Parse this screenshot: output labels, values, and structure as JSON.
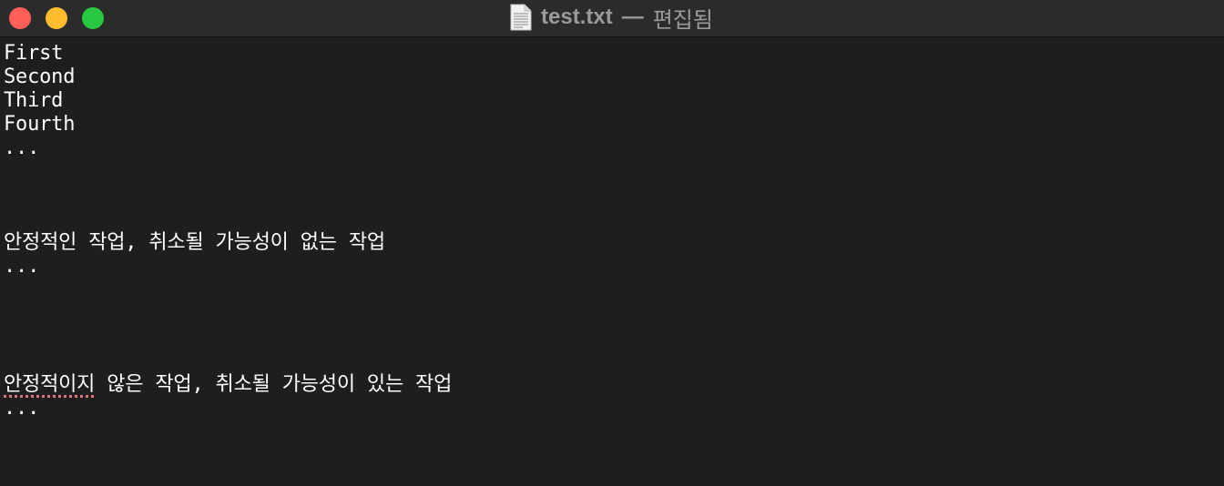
{
  "window": {
    "title": "test.txt",
    "title_separator": "—",
    "title_status": "편집됨",
    "document_icon": "text-document-icon",
    "buttons": {
      "close_color": "#ff5f57",
      "minimize_color": "#febc2e",
      "zoom_color": "#28c840"
    }
  },
  "colors": {
    "titlebar_bg": "#2b2b2b",
    "editor_bg": "#1e1e1e",
    "text": "#ffffff",
    "title_text": "#9a9a9a",
    "spellcheck_underline": "#e0707a"
  },
  "editor": {
    "lines": [
      {
        "text": "First"
      },
      {
        "text": "Second"
      },
      {
        "text": "Third"
      },
      {
        "text": "Fourth"
      },
      {
        "text": "..."
      },
      {
        "text": ""
      },
      {
        "text": ""
      },
      {
        "text": ""
      },
      {
        "text": "안정적인 작업, 취소될 가능성이 없는 작업"
      },
      {
        "text": "..."
      },
      {
        "text": ""
      },
      {
        "text": ""
      },
      {
        "text": ""
      },
      {
        "text": ""
      },
      {
        "segments": [
          {
            "text": "안정적이지",
            "misspelled": true
          },
          {
            "text": " 않은 작업, 취소될 가능성이 있는 작업",
            "misspelled": false
          }
        ]
      },
      {
        "text": "..."
      }
    ]
  }
}
